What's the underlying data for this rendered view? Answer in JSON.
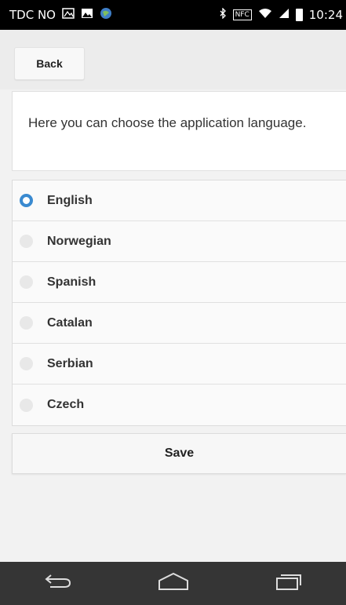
{
  "status_bar": {
    "carrier": "TDC NO",
    "nfc_label": "NFC",
    "time": "10:24",
    "icons": [
      "notification-icon",
      "gallery-icon",
      "globe-icon",
      "bluetooth-icon",
      "nfc-icon",
      "wifi-icon",
      "signal-icon",
      "battery-icon"
    ]
  },
  "header": {
    "back_label": "Back"
  },
  "intro": {
    "text": "Here you can choose the application language."
  },
  "languages": [
    {
      "label": "English",
      "selected": true
    },
    {
      "label": "Norwegian",
      "selected": false
    },
    {
      "label": "Spanish",
      "selected": false
    },
    {
      "label": "Catalan",
      "selected": false
    },
    {
      "label": "Serbian",
      "selected": false
    },
    {
      "label": "Czech",
      "selected": false
    }
  ],
  "save_label": "Save",
  "colors": {
    "accent": "#3a8ad0",
    "navbar": "#353535",
    "status_bar": "#000000"
  },
  "nav_bar": {
    "icons": [
      "back-nav-icon",
      "home-nav-icon",
      "recents-nav-icon"
    ]
  }
}
